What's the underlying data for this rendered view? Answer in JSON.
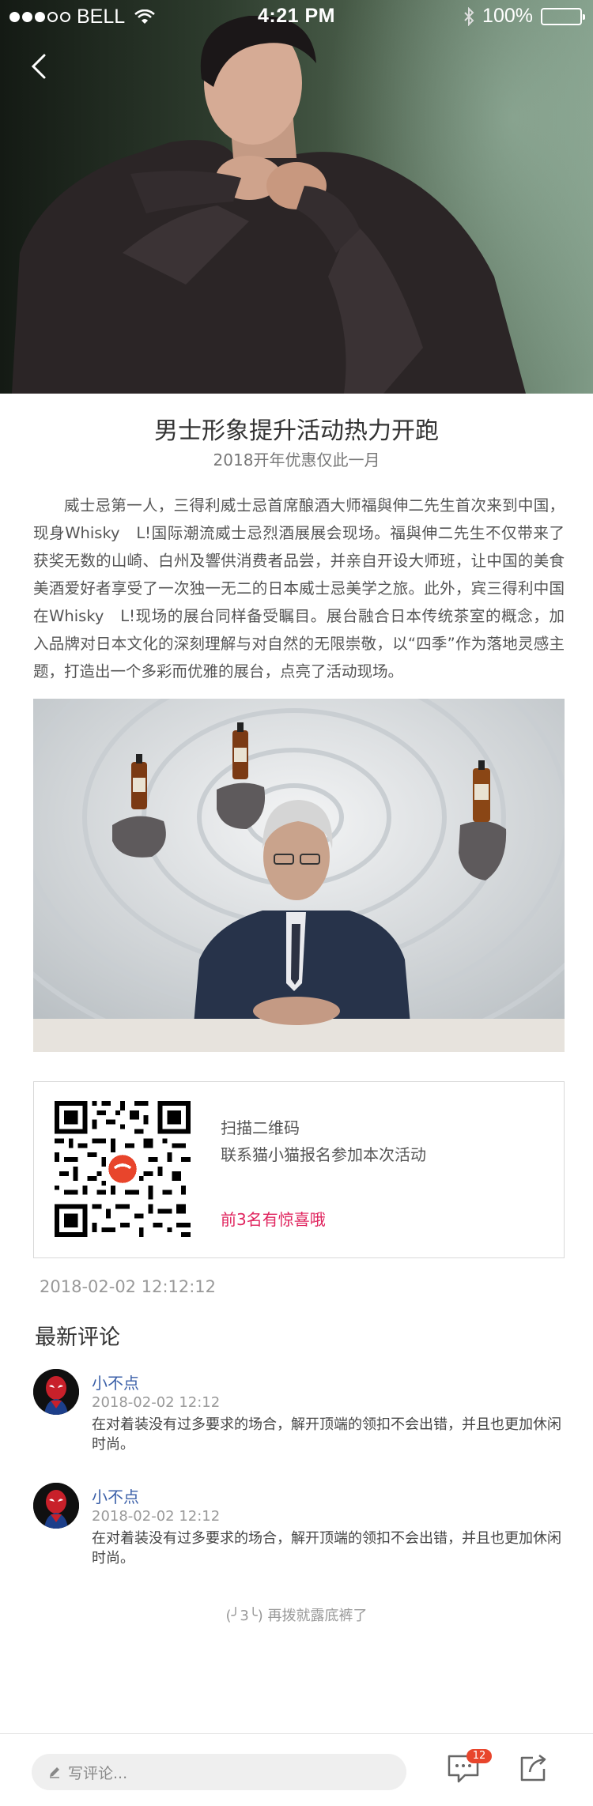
{
  "status_bar": {
    "carrier": "BELL",
    "time": "4:21 PM",
    "battery": "100%"
  },
  "article": {
    "title": "男士形象提升活动热力开跑",
    "subtitle": "2018开年优惠仅此一月",
    "body": "威士忌第一人，三得利威士忌首席酿酒大师福與伸二先生首次来到中国，现身Whisky　L!国际潮流威士忌烈酒展展会现场。福與伸二先生不仅带来了获奖无数的山崎、白州及響供消费者品尝，并亲自开设大师班，让中国的美食美酒爱好者享受了一次独一无二的日本威士忌美学之旅。此外，宾三得利中国在Whisky　L!现场的展台同样备受瞩目。展台融合日本传统茶室的概念，加入品牌对日本文化的深刻理解与对自然的无限崇敬，以“四季”作为落地灵感主题，打造出一个多彩而优雅的展台，点亮了活动现场。",
    "post_time": "2018-02-02  12:12:12"
  },
  "qr": {
    "line1": "扫描二维码",
    "line2": "联系猫小猫报名参加本次活动",
    "highlight": "前3名有惊喜哦",
    "highlight_color": "#e0245e"
  },
  "comments_section": {
    "title": "最新评论",
    "items": [
      {
        "name": "小不点",
        "time": "2018-02-02  12:12",
        "text": "在对着装没有过多要求的场合，解开顶端的领扣不会出错，并且也更加休闲时尚。"
      },
      {
        "name": "小不点",
        "time": "2018-02-02  12:12",
        "text": "在对着装没有过多要求的场合，解开顶端的领扣不会出错，并且也更加休闲时尚。"
      }
    ],
    "end_hint": "(╯3╰) 再拨就露底裤了"
  },
  "bottom_bar": {
    "input_placeholder": "写评论...",
    "message_count": "12"
  },
  "icons": {
    "back": "chevron-left-icon",
    "wifi": "wifi-icon",
    "bluetooth": "bluetooth-icon",
    "battery": "battery-icon",
    "pencil": "pencil-icon",
    "message": "message-icon",
    "share": "share-icon"
  },
  "colors": {
    "accent_pink": "#e0245e",
    "name_blue": "#3a5fa8",
    "badge_red": "#e8452c"
  }
}
